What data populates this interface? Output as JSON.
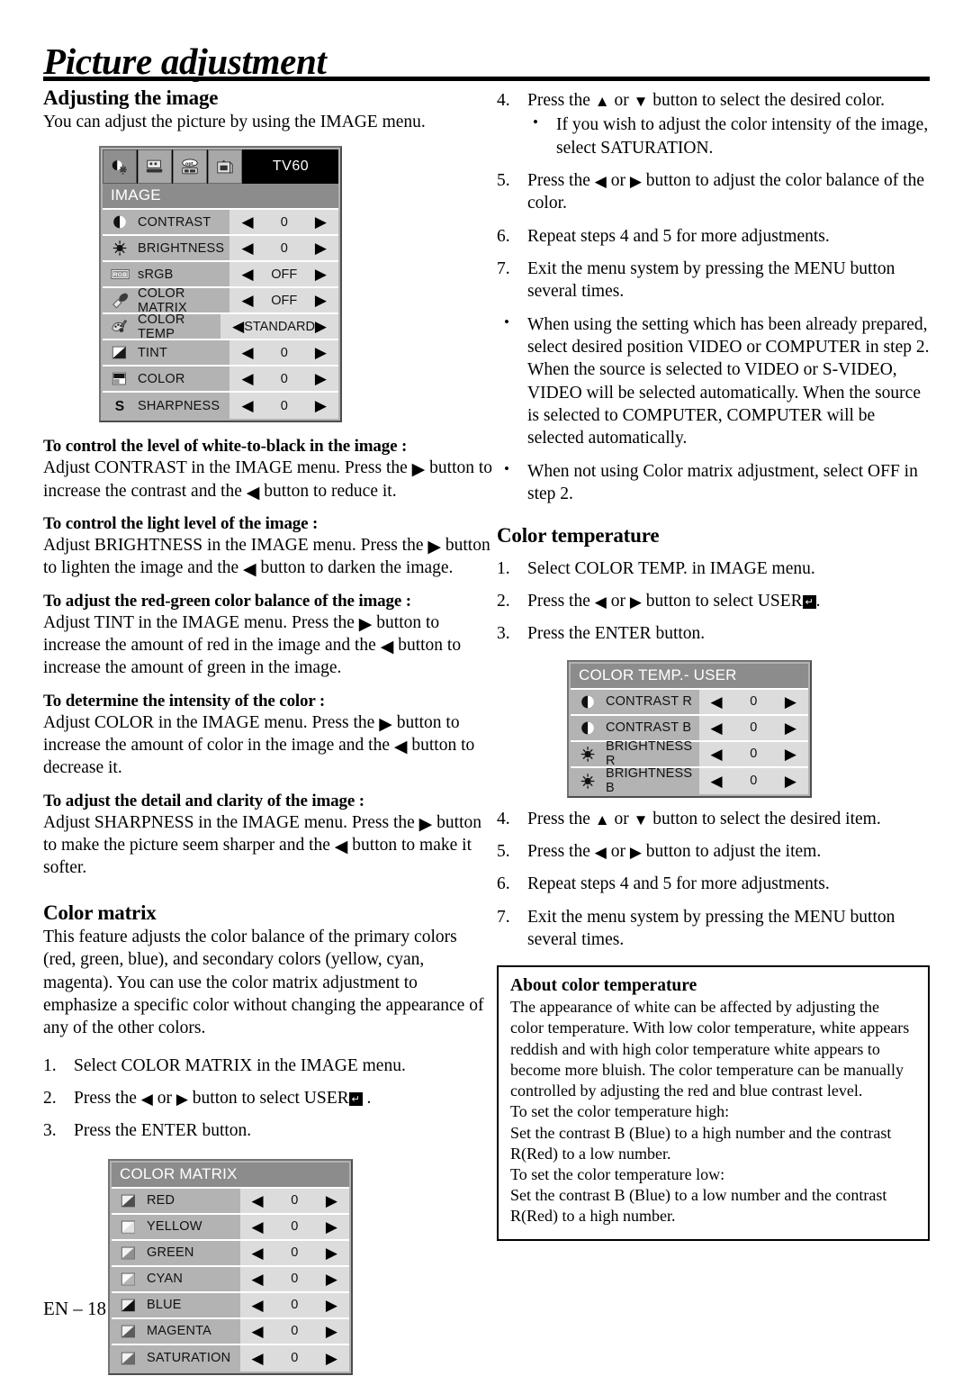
{
  "header": {
    "title": "Picture adjustment"
  },
  "footer": {
    "page_label": "EN – 18"
  },
  "left": {
    "adjusting": {
      "heading": "Adjusting the image",
      "intro": "You can adjust the picture by using the IMAGE menu."
    },
    "image_menu": {
      "source_label": "TV60",
      "menu_title": "IMAGE",
      "tabs": [
        {
          "name": "image-tab",
          "icon": "contrast-brightness-icon",
          "active": true
        },
        {
          "name": "install-tab",
          "icon": "projector-screen-icon",
          "active": false
        },
        {
          "name": "option-tab",
          "icon": "opt-icon",
          "active": false
        },
        {
          "name": "signal-tab",
          "icon": "signal-icon",
          "active": false
        }
      ],
      "rows": [
        {
          "icon": "contrast-icon",
          "label": "CONTRAST",
          "value": "0"
        },
        {
          "icon": "brightness-icon",
          "label": "BRIGHTNESS",
          "value": "0"
        },
        {
          "icon": "srgb-icon",
          "label": "sRGB",
          "value": "OFF"
        },
        {
          "icon": "color-matrix-icon",
          "label": "COLOR MATRIX",
          "value": "OFF"
        },
        {
          "icon": "color-temp-icon",
          "label": "COLOR TEMP",
          "value": "STANDARD"
        },
        {
          "icon": "tint-icon",
          "label": "TINT",
          "value": "0"
        },
        {
          "icon": "color-icon",
          "label": "COLOR",
          "value": "0"
        },
        {
          "icon": "sharpness-icon",
          "label": "SHARPNESS",
          "value": "0"
        }
      ]
    },
    "blocks": [
      {
        "subhead": "To control the level of white-to-black in the image :",
        "body_html": "Adjust CONTRAST in the IMAGE menu.  Press the <span class=\"tri-lg\">▶</span> button to increase the contrast and the <span class=\"tri-lg\">◀</span> button to reduce it."
      },
      {
        "subhead": "To control the light level of the image :",
        "body_html": "Adjust BRIGHTNESS in the IMAGE menu.  Press the <span class=\"tri-lg\">▶</span> button to lighten the image and the <span class=\"tri-lg\">◀</span> button to darken the image."
      },
      {
        "subhead": "To adjust the red-green color balance of the image :",
        "body_html": "Adjust TINT in the IMAGE menu.  Press the <span class=\"tri-lg\">▶</span> button to increase the amount of red in the image and the <span class=\"tri-lg\">◀</span> button to increase the amount of green in the image."
      },
      {
        "subhead": "To determine the intensity of the color :",
        "body_html": "Adjust COLOR in the IMAGE menu.  Press the <span class=\"tri-lg\">▶</span> button to increase the amount of color in the image and the <span class=\"tri-lg\">◀</span> button to decrease it."
      },
      {
        "subhead": "To adjust the detail and clarity of the image :",
        "body_html": "Adjust SHARPNESS in the IMAGE menu.  Press the <span class=\"tri-lg\">▶</span> button to make the picture seem sharper and the <span class=\"tri-lg\">◀</span> button to make it softer."
      }
    ],
    "color_matrix": {
      "heading": "Color matrix",
      "intro": "This feature adjusts the color balance of the primary colors (red, green, blue), and secondary colors (yellow, cyan, magenta). You can use the color matrix adjustment to emphasize a specific color without changing the appearance of any of the other colors.",
      "steps": [
        {
          "num": "1.",
          "html": "Select COLOR MATRIX in the IMAGE menu."
        },
        {
          "num": "2.",
          "html": "Press the <span class=\"tri\">◀</span> or <span class=\"tri\">▶</span> button to select USER<span class=\"enterico\"></span> ."
        },
        {
          "num": "3.",
          "html": "Press the ENTER button."
        }
      ],
      "menu": {
        "menu_title": "COLOR MATRIX",
        "rows": [
          {
            "icon": "red-swatch-icon",
            "label": "RED",
            "value": "0"
          },
          {
            "icon": "yellow-swatch-icon",
            "label": "YELLOW",
            "value": "0"
          },
          {
            "icon": "green-swatch-icon",
            "label": "GREEN",
            "value": "0"
          },
          {
            "icon": "cyan-swatch-icon",
            "label": "CYAN",
            "value": "0"
          },
          {
            "icon": "blue-swatch-icon",
            "label": "BLUE",
            "value": "0"
          },
          {
            "icon": "magenta-swatch-icon",
            "label": "MAGENTA",
            "value": "0"
          },
          {
            "icon": "saturation-swatch-icon",
            "label": "SATURATION",
            "value": "0"
          }
        ]
      }
    }
  },
  "right": {
    "matrix_steps": [
      {
        "num": "4.",
        "html": "Press the <span class=\"tri\">▲</span> or <span class=\"tri\">▼</span> button to select the desired color.",
        "sub": [
          "If you wish to adjust the color intensity of the image, select SATURATION."
        ]
      },
      {
        "num": "5.",
        "html": "Press the <span class=\"tri\">◀</span> or <span class=\"tri\">▶</span> button to adjust the color balance of the color."
      },
      {
        "num": "6.",
        "html": "Repeat steps 4 and 5 for more adjustments."
      },
      {
        "num": "7.",
        "html": "Exit the menu system by pressing the MENU button several times."
      }
    ],
    "matrix_notes": [
      "When using the setting which has been already prepared, select desired position VIDEO or COMPUTER in step 2.  When the source is selected to VIDEO or S-VIDEO, VIDEO will be selected automatically. When the source is selected to COMPUTER, COMPUTER will be selected automatically.",
      "When not using Color matrix adjustment, select OFF in step 2."
    ],
    "color_temperature": {
      "heading": "Color temperature",
      "steps_top": [
        {
          "num": "1.",
          "html": "Select COLOR TEMP. in IMAGE menu."
        },
        {
          "num": "2.",
          "html": "Press the <span class=\"tri\">◀</span> or <span class=\"tri\">▶</span> button to select USER<span class=\"enterico\"></span>."
        },
        {
          "num": "3.",
          "html": "Press the ENTER button."
        }
      ],
      "menu": {
        "menu_title": "COLOR TEMP.- USER",
        "rows": [
          {
            "icon": "contrast-icon",
            "label": "CONTRAST R",
            "value": "0"
          },
          {
            "icon": "contrast-icon",
            "label": "CONTRAST B",
            "value": "0"
          },
          {
            "icon": "brightness-icon",
            "label": "BRIGHTNESS R",
            "value": "0"
          },
          {
            "icon": "brightness-icon",
            "label": "BRIGHTNESS B",
            "value": "0"
          }
        ]
      },
      "steps_bottom": [
        {
          "num": "4.",
          "html": "Press the <span class=\"tri\">▲</span> or <span class=\"tri\">▼</span> button to select the desired item."
        },
        {
          "num": "5.",
          "html": "Press the <span class=\"tri\">◀</span> or <span class=\"tri\">▶</span> button to adjust the item."
        },
        {
          "num": "6.",
          "html": "Repeat steps 4 and 5 for more adjustments."
        },
        {
          "num": "7.",
          "html": "Exit the menu system by pressing the MENU button several times."
        }
      ]
    },
    "about_box": {
      "heading": "About color temperature",
      "lines": [
        "The appearance of white can be affected by adjusting the color temperature. With low color temperature, white appears reddish and with high color temperature white appears to become more bluish. The color temperature can be manually controlled by adjusting the red and blue contrast level.",
        "To set the color temperature high:",
        "Set the contrast B (Blue) to a high number and the contrast R(Red) to a low number.",
        "To set the color temperature low:",
        "Set the contrast B (Blue) to a low number and the contrast R(Red) to a high number."
      ]
    }
  }
}
